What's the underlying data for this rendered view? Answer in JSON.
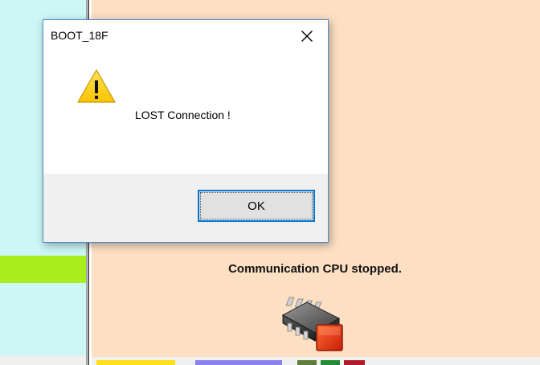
{
  "dialog": {
    "title": "BOOT_18F",
    "message": "LOST Connection !",
    "ok_label": "OK",
    "icon": "warning-icon",
    "close_icon": "close-icon"
  },
  "main": {
    "status_text": "Communication CPU stopped.",
    "status_icon": "cpu-chip-stopped-icon"
  },
  "colors": {
    "left_panel": "#cdf6f6",
    "right_panel": "#fddfc3",
    "green_bar": "#a8ee1c",
    "accent": "#0078d7",
    "warning": "#ffd21f",
    "stopped": "#e53a14"
  }
}
